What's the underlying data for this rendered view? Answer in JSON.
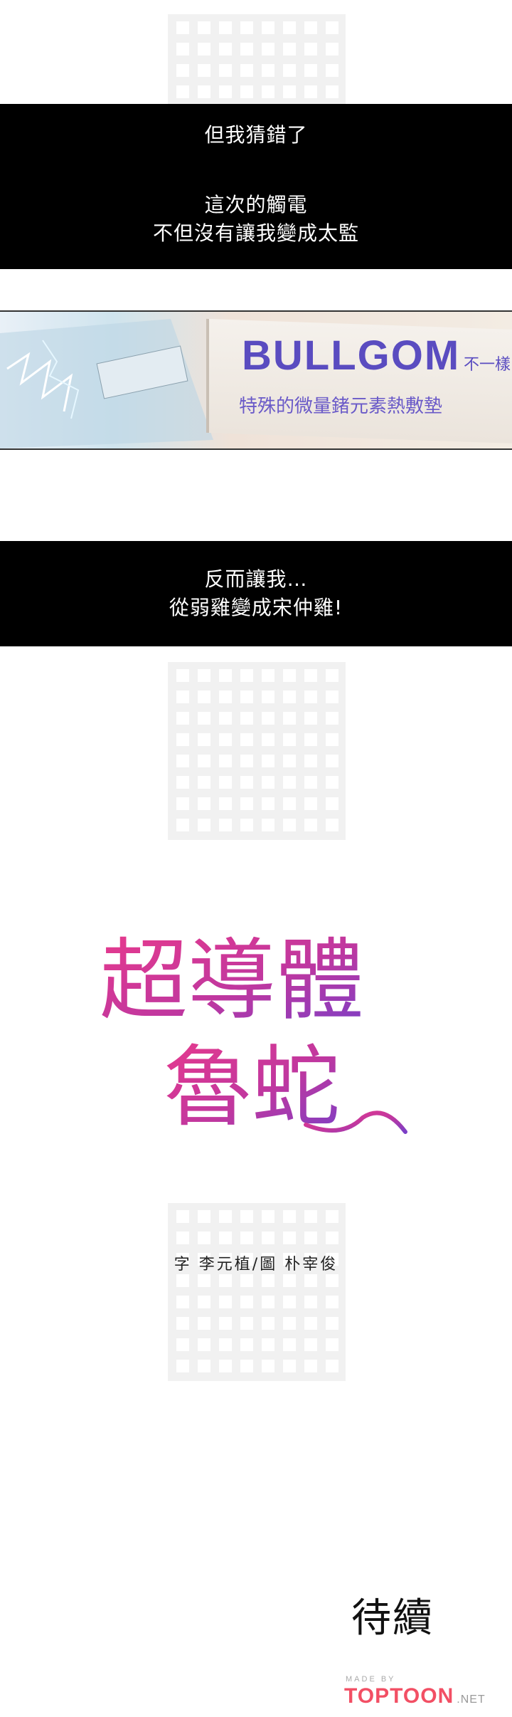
{
  "caption_box_1": {
    "line1": "但我猜錯了",
    "line2": "這次的觸電",
    "line3": "不但沒有讓我變成太監"
  },
  "scene": {
    "sign_brand": "BULLGOM",
    "sign_brand_suffix": "不一樣",
    "sign_subtitle": "特殊的微量鍺元素熱敷墊"
  },
  "caption_box_2": {
    "line1": "反而讓我…",
    "line2": "從弱雞變成宋仲雞!"
  },
  "title": {
    "line1": "超導體",
    "line2": "魯蛇"
  },
  "credits": "字 李元植/圖 朴宰俊",
  "to_be_continued": "待續",
  "footer": {
    "made_by": "MADE BY",
    "brand": "TOPTOON",
    "tld": ".NET"
  },
  "colors": {
    "caption_bg": "#000000",
    "caption_text": "#ffffff",
    "title_gradient_start": "#e83a8c",
    "title_gradient_end": "#7a3fc7",
    "brand_red": "#f24f64"
  }
}
